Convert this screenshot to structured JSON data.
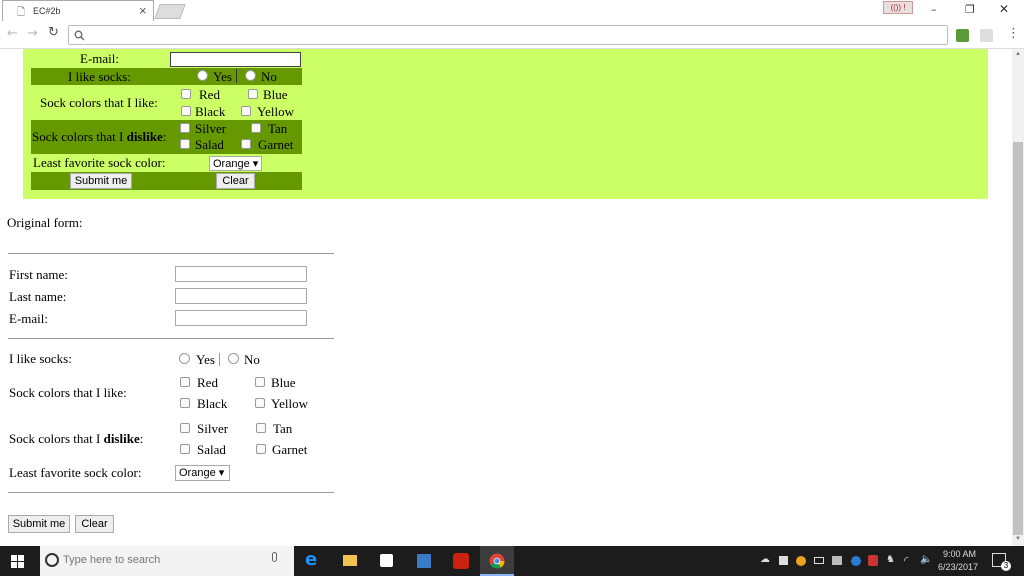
{
  "browser": {
    "tab_title": "EC#2b",
    "tab_close": "×",
    "url": "",
    "window_controls": {
      "minimize": "–",
      "restore": "❐",
      "close": "✕"
    },
    "profile_badge": "(()) !",
    "extensions": [
      "w-icon",
      "person-icon"
    ],
    "menu": "⋮"
  },
  "styled_form": {
    "email_label": "E-mail:",
    "socks_label": "I like socks:",
    "yes": "Yes",
    "no": "No",
    "like_label": "Sock colors that I like:",
    "dislike_prefix": "Sock colors that I ",
    "dislike_bold": "dislike",
    "dislike_suffix": ":",
    "colors_like": [
      "Red",
      "Blue",
      "Black",
      "Yellow"
    ],
    "colors_dislike": [
      "Silver",
      "Tan",
      "Salad",
      "Garnet"
    ],
    "least_label": "Least favorite sock color:",
    "least_value": "Orange ▾",
    "submit": "Submit me",
    "clear": "Clear"
  },
  "original_form": {
    "heading": "Original form:",
    "first_name_label": "First name:",
    "last_name_label": "Last name:",
    "email_label": "E-mail:",
    "socks_label": "I like socks:",
    "yes": "Yes",
    "no": "No",
    "like_label": "Sock colors that I like:",
    "dislike_prefix": "Sock colors that I ",
    "dislike_bold": "dislike",
    "dislike_suffix": ":",
    "colors_like": [
      "Red",
      "Blue",
      "Black",
      "Yellow"
    ],
    "colors_dislike": [
      "Silver",
      "Tan",
      "Salad",
      "Garnet"
    ],
    "least_label": "Least favorite sock color:",
    "least_value": "Orange ▾",
    "submit": "Submit me",
    "clear": "Clear"
  },
  "taskbar": {
    "search_placeholder": "Type here to search",
    "time": "9:00 AM",
    "date": "6/23/2017",
    "notification_count": "3"
  },
  "colors": {
    "styled_bg": "#ccff66",
    "styled_dark_row": "#669900",
    "taskbar_bg": "#1c1c1c"
  }
}
